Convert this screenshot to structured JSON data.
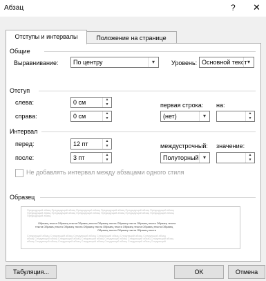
{
  "window": {
    "title": "Абзац",
    "help_label": "?",
    "close_label": "✕"
  },
  "tabs": [
    {
      "label": "Отступы и интервалы",
      "active": true
    },
    {
      "label": "Положение на странице",
      "active": false
    }
  ],
  "general": {
    "heading": "Общие",
    "alignment_label": "Выравнивание:",
    "alignment_value": "По центру",
    "level_label": "Уровень:",
    "level_value": "Основной текст"
  },
  "indent": {
    "heading": "Отступ",
    "left_label": "слева:",
    "left_value": "0 см",
    "right_label": "справа:",
    "right_value": "0 см",
    "first_line_label": "первая строка:",
    "first_line_value": "(нет)",
    "on_label": "на:",
    "on_value": ""
  },
  "spacing": {
    "heading": "Интервал",
    "before_label": "перед:",
    "before_value": "12 пт",
    "after_label": "после:",
    "after_value": "3 пт",
    "line_spacing_label": "междустрочный:",
    "line_spacing_value": "Полуторный",
    "value_label": "значение:",
    "value_value": "",
    "no_space_label": "Не добавлять интервал между абзацами одного стиля"
  },
  "sample": {
    "heading": "Образец",
    "prev_lines": [
      "Предыдущий абзац Предыдущий абзац Предыдущий абзац Предыдущий абзац Предыдущий абзац Предыдущий абзац",
      "Предыдущий абзац Предыдущий абзац Предыдущий абзац Предыдущий абзац Предыдущий абзац Предыдущий абзац",
      "Предыдущий абзац"
    ],
    "sample_lines": [
      "Образец текста Образец текста Образец текста Образец текста Образец текста Образец текста Образец текста",
      "текста Образец текста Образец текста Образец текста Образец текста Образец текста Образец текста Образец",
      "Образец текста Образец текста Образец текста"
    ],
    "next_lines": [
      "Следующий абзац Следующий абзац Следующий абзац Следующий абзац Следующий абзац Следующий абзац",
      "абзац Следующий абзац Следующий абзац Следующий абзац Следующий абзац Следующий абзац Следующий абзац",
      "абзац Следующий абзац Следующий абзац Следующий абзац Следующий абзац Следующий абзац Следующий"
    ]
  },
  "footer": {
    "tabs_button": "Табуляция...",
    "ok_button": "OK",
    "cancel_button": "Отмена"
  }
}
